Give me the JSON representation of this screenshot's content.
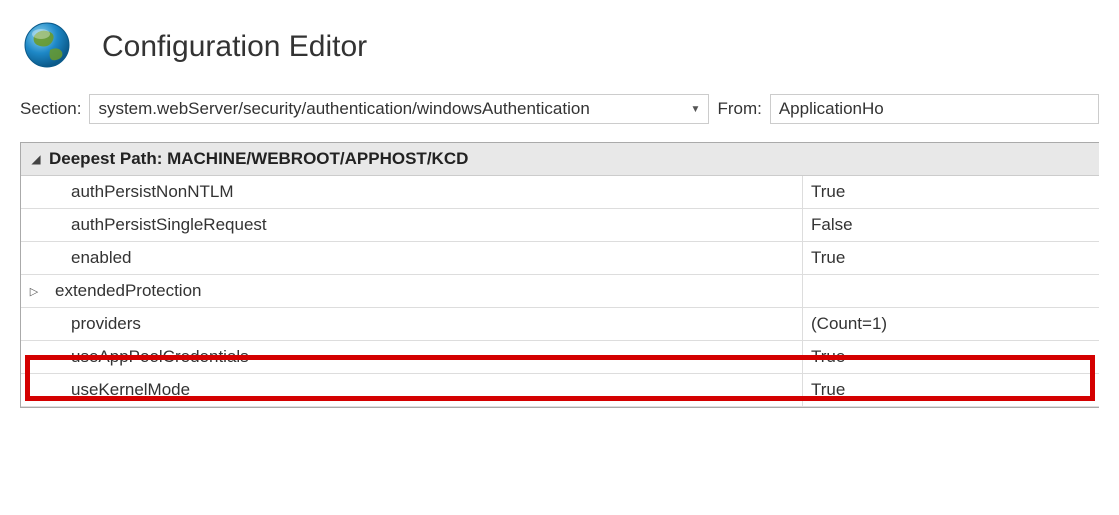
{
  "header": {
    "title": "Configuration Editor"
  },
  "toolbar": {
    "section_label": "Section:",
    "section_value": "system.webServer/security/authentication/windowsAuthentication",
    "from_label": "From:",
    "from_value": "ApplicationHo"
  },
  "grid": {
    "header_prefix": "Deepest Path: ",
    "header_path": "MACHINE/WEBROOT/APPHOST/KCD",
    "rows": [
      {
        "name": "authPersistNonNTLM",
        "value": "True",
        "expandable": false
      },
      {
        "name": "authPersistSingleRequest",
        "value": "False",
        "expandable": false
      },
      {
        "name": "enabled",
        "value": "True",
        "expandable": false
      },
      {
        "name": "extendedProtection",
        "value": "",
        "expandable": true
      },
      {
        "name": "providers",
        "value": "(Count=1)",
        "expandable": false
      },
      {
        "name": "useAppPoolCredentials",
        "value": "True",
        "expandable": false
      },
      {
        "name": "useKernelMode",
        "value": "True",
        "expandable": false
      }
    ]
  }
}
